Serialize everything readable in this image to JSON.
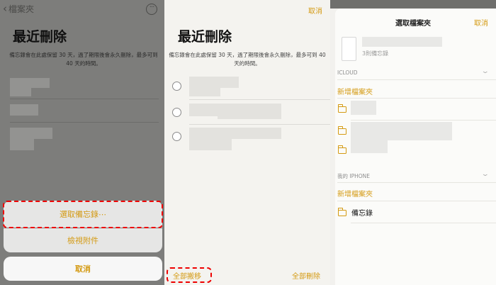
{
  "panel1": {
    "back_label": "檔案夾",
    "more_label": "···",
    "title": "最近刪除",
    "description": "備忘錄會在此處保留 30 天，過了期限後會永久刪除，最多可到 40 天的時間。",
    "action_sheet": {
      "select_notes": "選取備忘錄⋯",
      "view_attachments": "檢視附件",
      "cancel": "取消"
    }
  },
  "panel2": {
    "cancel_label": "取消",
    "title": "最近刪除",
    "description": "備忘錄會在此處保留 30 天，過了期限後會永久刪除，最多可到 40 天的時間。",
    "move_all_label": "全部搬移",
    "delete_all_label": "全部刪除"
  },
  "panel3": {
    "header": "選取檔案夾",
    "cancel_label": "取消",
    "note_count": "3則備忘錄",
    "sections": [
      {
        "name": "ICLOUD",
        "new_folder": "新增檔案夾"
      },
      {
        "name": "我的 IPHONE",
        "new_folder": "新增檔案夾",
        "folder": "備忘錄"
      }
    ]
  },
  "colors": {
    "accent": "#d49a12",
    "highlight_dash": "#ee0000"
  },
  "icons": [
    "chevron-left-icon",
    "more-icon",
    "radio-icon",
    "folder-icon",
    "chevron-down-icon"
  ]
}
